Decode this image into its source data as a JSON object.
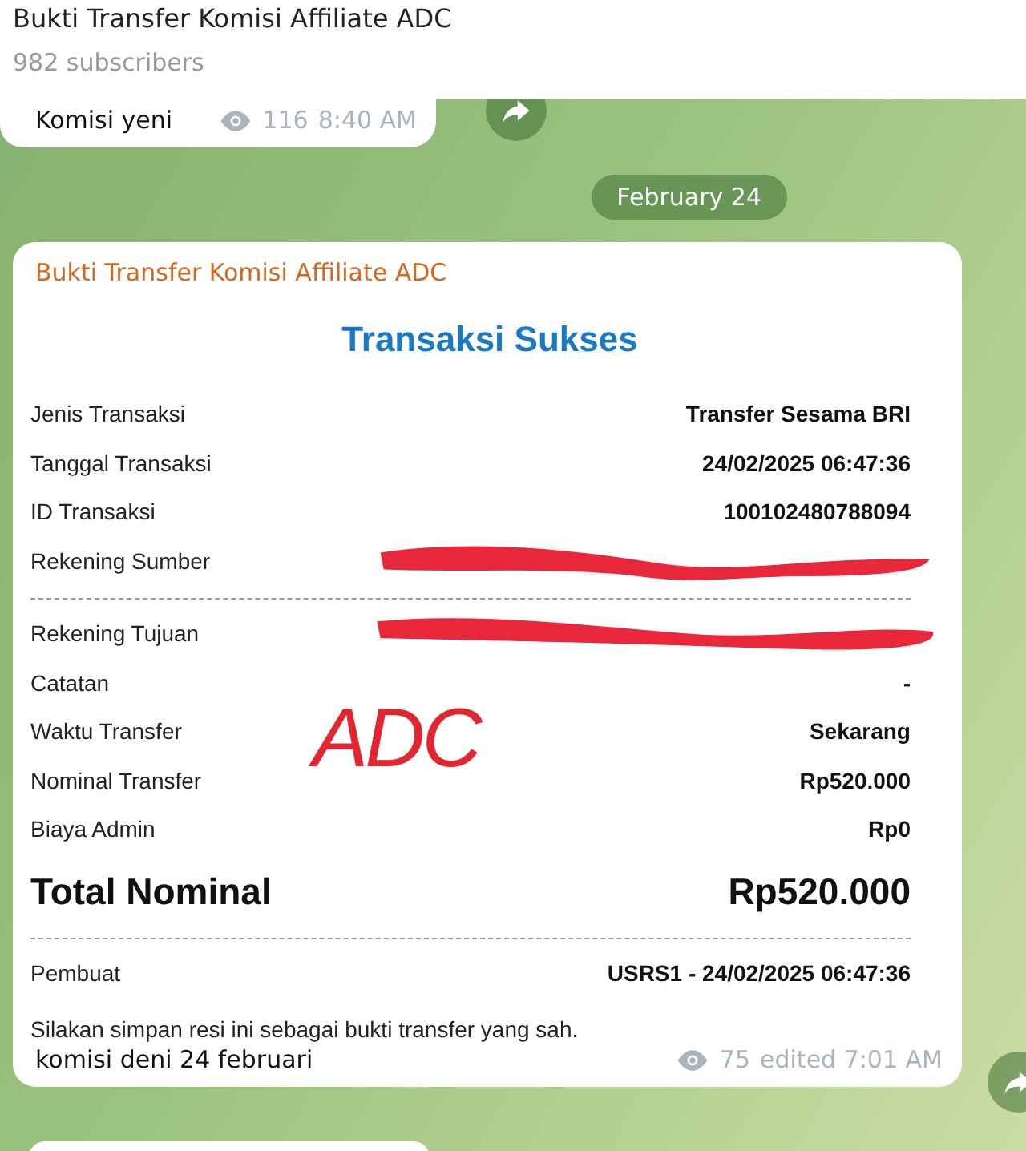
{
  "header": {
    "title": "Bukti Transfer Komisi Affiliate ADC",
    "subtitle": "982 subscribers"
  },
  "first_message": {
    "text": "Komisi yeni",
    "views": "116",
    "time": "8:40 AM"
  },
  "date_separator": {
    "label": "February 24"
  },
  "post": {
    "sender": "Bukti Transfer Komisi Affiliate ADC",
    "caption": "komisi deni 24 februari",
    "views": "75",
    "time": "edited 7:01 AM",
    "receipt": {
      "title": "Transaksi Sukses",
      "rows_top": [
        {
          "label": "Jenis Transaksi",
          "value": "Transfer Sesama BRI",
          "redacted": false
        },
        {
          "label": "Tanggal Transaksi",
          "value": "24/02/2025 06:47:36",
          "redacted": false
        },
        {
          "label": "ID Transaksi",
          "value": "100102480788094",
          "redacted": false
        },
        {
          "label": "Rekening Sumber",
          "redacted": true
        }
      ],
      "rows_bottom": [
        {
          "label": "Rekening Tujuan",
          "redacted": true
        },
        {
          "label": "Catatan",
          "value": "-",
          "redacted": false
        },
        {
          "label": "Waktu Transfer",
          "value": "Sekarang",
          "redacted": false
        },
        {
          "label": "Nominal Transfer",
          "value": "Rp520.000",
          "redacted": false
        },
        {
          "label": "Biaya Admin",
          "value": "Rp0",
          "redacted": false
        }
      ],
      "total": {
        "label": "Total Nominal",
        "value": "Rp520.000"
      },
      "creator": {
        "label": "Pembuat",
        "value": "USRS1 - 24/02/2025 06:47:36"
      },
      "note": "Silakan simpan resi ini sebagai bukti transfer yang sah.",
      "handwriting": "ADC"
    }
  }
}
